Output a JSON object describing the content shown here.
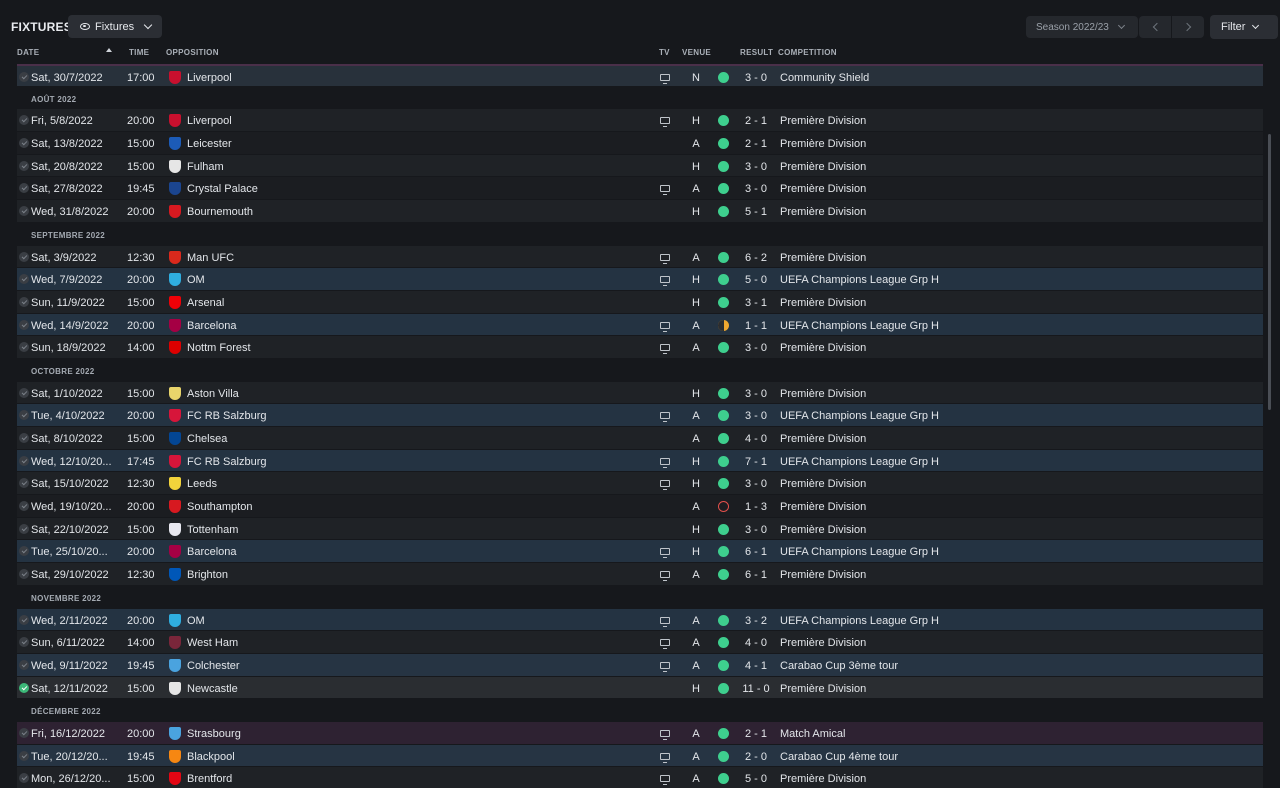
{
  "header": {
    "title": "FIXTURES",
    "view_dropdown": "Fixtures",
    "season": "Season 2022/23",
    "filter": "Filter"
  },
  "columns": {
    "date": "DATE",
    "time": "TIME",
    "opposition": "OPPOSITION",
    "tv": "TV",
    "venue": "VENUE",
    "result": "RESULT",
    "competition": "COMPETITION"
  },
  "rows": [
    {
      "kind": "fixture",
      "style": "first",
      "date": "Sat, 30/7/2022",
      "time": "17:00",
      "opp": "Liverpool",
      "crest": "#c8102e",
      "tv": true,
      "venue": "N",
      "result": "win",
      "score": "3 - 0",
      "comp": "Community Shield"
    },
    {
      "kind": "month",
      "label": "AOÛT 2022"
    },
    {
      "kind": "fixture",
      "style": "",
      "date": "Fri, 5/8/2022",
      "time": "20:00",
      "opp": "Liverpool",
      "crest": "#c8102e",
      "tv": true,
      "venue": "H",
      "result": "win",
      "score": "2 - 1",
      "comp": "Première Division"
    },
    {
      "kind": "fixture",
      "style": "alt",
      "date": "Sat, 13/8/2022",
      "time": "15:00",
      "opp": "Leicester",
      "crest": "#1c5bb7",
      "tv": false,
      "venue": "A",
      "result": "win",
      "score": "2 - 1",
      "comp": "Première Division"
    },
    {
      "kind": "fixture",
      "style": "",
      "date": "Sat, 20/8/2022",
      "time": "15:00",
      "opp": "Fulham",
      "crest": "#e6e6e6",
      "tv": false,
      "venue": "H",
      "result": "win",
      "score": "3 - 0",
      "comp": "Première Division"
    },
    {
      "kind": "fixture",
      "style": "alt",
      "date": "Sat, 27/8/2022",
      "time": "19:45",
      "opp": "Crystal Palace",
      "crest": "#1b458f",
      "tv": true,
      "venue": "A",
      "result": "win",
      "score": "3 - 0",
      "comp": "Première Division"
    },
    {
      "kind": "fixture",
      "style": "",
      "date": "Wed, 31/8/2022",
      "time": "20:00",
      "opp": "Bournemouth",
      "crest": "#d71920",
      "tv": false,
      "venue": "H",
      "result": "win",
      "score": "5 - 1",
      "comp": "Première Division"
    },
    {
      "kind": "month",
      "label": "SEPTEMBRE 2022"
    },
    {
      "kind": "fixture",
      "style": "",
      "date": "Sat, 3/9/2022",
      "time": "12:30",
      "opp": "Man UFC",
      "crest": "#da291c",
      "tv": true,
      "venue": "A",
      "result": "win",
      "score": "6 - 2",
      "comp": "Première Division"
    },
    {
      "kind": "fixture",
      "style": "euro",
      "date": "Wed, 7/9/2022",
      "time": "20:00",
      "opp": "OM",
      "crest": "#2faee0",
      "tv": true,
      "venue": "H",
      "result": "win",
      "score": "5 - 0",
      "comp": "UEFA Champions League Grp H"
    },
    {
      "kind": "fixture",
      "style": "",
      "date": "Sun, 11/9/2022",
      "time": "15:00",
      "opp": "Arsenal",
      "crest": "#ef0107",
      "tv": false,
      "venue": "H",
      "result": "win",
      "score": "3 - 1",
      "comp": "Première Division"
    },
    {
      "kind": "fixture",
      "style": "euro",
      "date": "Wed, 14/9/2022",
      "time": "20:00",
      "opp": "Barcelona",
      "crest": "#a50044",
      "tv": true,
      "venue": "A",
      "result": "draw",
      "score": "1 - 1",
      "comp": "UEFA Champions League Grp H"
    },
    {
      "kind": "fixture",
      "style": "",
      "date": "Sun, 18/9/2022",
      "time": "14:00",
      "opp": "Nottm Forest",
      "crest": "#dd0000",
      "tv": true,
      "venue": "A",
      "result": "win",
      "score": "3 - 0",
      "comp": "Première Division"
    },
    {
      "kind": "month",
      "label": "OCTOBRE 2022"
    },
    {
      "kind": "fixture",
      "style": "",
      "date": "Sat, 1/10/2022",
      "time": "15:00",
      "opp": "Aston Villa",
      "crest": "#e8d46b",
      "tv": false,
      "venue": "H",
      "result": "win",
      "score": "3 - 0",
      "comp": "Première Division"
    },
    {
      "kind": "fixture",
      "style": "euro",
      "date": "Tue, 4/10/2022",
      "time": "20:00",
      "opp": "FC RB Salzburg",
      "crest": "#d7153a",
      "tv": true,
      "venue": "A",
      "result": "win",
      "score": "3 - 0",
      "comp": "UEFA Champions League Grp H"
    },
    {
      "kind": "fixture",
      "style": "",
      "date": "Sat, 8/10/2022",
      "time": "15:00",
      "opp": "Chelsea",
      "crest": "#034694",
      "tv": false,
      "venue": "A",
      "result": "win",
      "score": "4 - 0",
      "comp": "Première Division"
    },
    {
      "kind": "fixture",
      "style": "euro",
      "date": "Wed, 12/10/20...",
      "time": "17:45",
      "opp": "FC RB Salzburg",
      "crest": "#d7153a",
      "tv": true,
      "venue": "H",
      "result": "win",
      "score": "7 - 1",
      "comp": "UEFA Champions League Grp H"
    },
    {
      "kind": "fixture",
      "style": "",
      "date": "Sat, 15/10/2022",
      "time": "12:30",
      "opp": "Leeds",
      "crest": "#f2d33b",
      "tv": true,
      "venue": "H",
      "result": "win",
      "score": "3 - 0",
      "comp": "Première Division"
    },
    {
      "kind": "fixture",
      "style": "alt",
      "date": "Wed, 19/10/20...",
      "time": "20:00",
      "opp": "Southampton",
      "crest": "#d71920",
      "tv": false,
      "venue": "A",
      "result": "loss",
      "score": "1 - 3",
      "comp": "Première Division"
    },
    {
      "kind": "fixture",
      "style": "",
      "date": "Sat, 22/10/2022",
      "time": "15:00",
      "opp": "Tottenham",
      "crest": "#e8e8f0",
      "tv": false,
      "venue": "H",
      "result": "win",
      "score": "3 - 0",
      "comp": "Première Division"
    },
    {
      "kind": "fixture",
      "style": "euro",
      "date": "Tue, 25/10/20...",
      "time": "20:00",
      "opp": "Barcelona",
      "crest": "#a50044",
      "tv": true,
      "venue": "H",
      "result": "win",
      "score": "6 - 1",
      "comp": "UEFA Champions League Grp H"
    },
    {
      "kind": "fixture",
      "style": "",
      "date": "Sat, 29/10/2022",
      "time": "12:30",
      "opp": "Brighton",
      "crest": "#0057b8",
      "tv": true,
      "venue": "A",
      "result": "win",
      "score": "6 - 1",
      "comp": "Première Division"
    },
    {
      "kind": "month",
      "label": "NOVEMBRE 2022"
    },
    {
      "kind": "fixture",
      "style": "euro",
      "date": "Wed, 2/11/2022",
      "time": "20:00",
      "opp": "OM",
      "crest": "#2faee0",
      "tv": true,
      "venue": "A",
      "result": "win",
      "score": "3 - 2",
      "comp": "UEFA Champions League Grp H"
    },
    {
      "kind": "fixture",
      "style": "",
      "date": "Sun, 6/11/2022",
      "time": "14:00",
      "opp": "West Ham",
      "crest": "#7a263a",
      "tv": true,
      "venue": "A",
      "result": "win",
      "score": "4 - 0",
      "comp": "Première Division"
    },
    {
      "kind": "fixture",
      "style": "cup",
      "date": "Wed, 9/11/2022",
      "time": "19:45",
      "opp": "Colchester",
      "crest": "#4aa3df",
      "tv": true,
      "venue": "A",
      "result": "win",
      "score": "4 - 1",
      "comp": "Carabao Cup 3ème tour"
    },
    {
      "kind": "fixture",
      "style": "current",
      "done": true,
      "date": "Sat, 12/11/2022",
      "time": "15:00",
      "opp": "Newcastle",
      "crest": "#e6e6e6",
      "tv": false,
      "venue": "H",
      "result": "win",
      "score": "11 - 0",
      "comp": "Première Division"
    },
    {
      "kind": "month",
      "label": "DÉCEMBRE 2022"
    },
    {
      "kind": "fixture",
      "style": "friendly",
      "date": "Fri, 16/12/2022",
      "time": "20:00",
      "opp": "Strasbourg",
      "crest": "#4aa3df",
      "tv": true,
      "venue": "A",
      "result": "win",
      "score": "2 - 1",
      "comp": "Match Amical"
    },
    {
      "kind": "fixture",
      "style": "cup",
      "date": "Tue, 20/12/20...",
      "time": "19:45",
      "opp": "Blackpool",
      "crest": "#f68712",
      "tv": true,
      "venue": "A",
      "result": "win",
      "score": "2 - 0",
      "comp": "Carabao Cup 4ème tour"
    },
    {
      "kind": "fixture",
      "style": "",
      "date": "Mon, 26/12/20...",
      "time": "15:00",
      "opp": "Brentford",
      "crest": "#e30613",
      "tv": true,
      "venue": "A",
      "result": "win",
      "score": "5 - 0",
      "comp": "Première Division"
    }
  ]
}
